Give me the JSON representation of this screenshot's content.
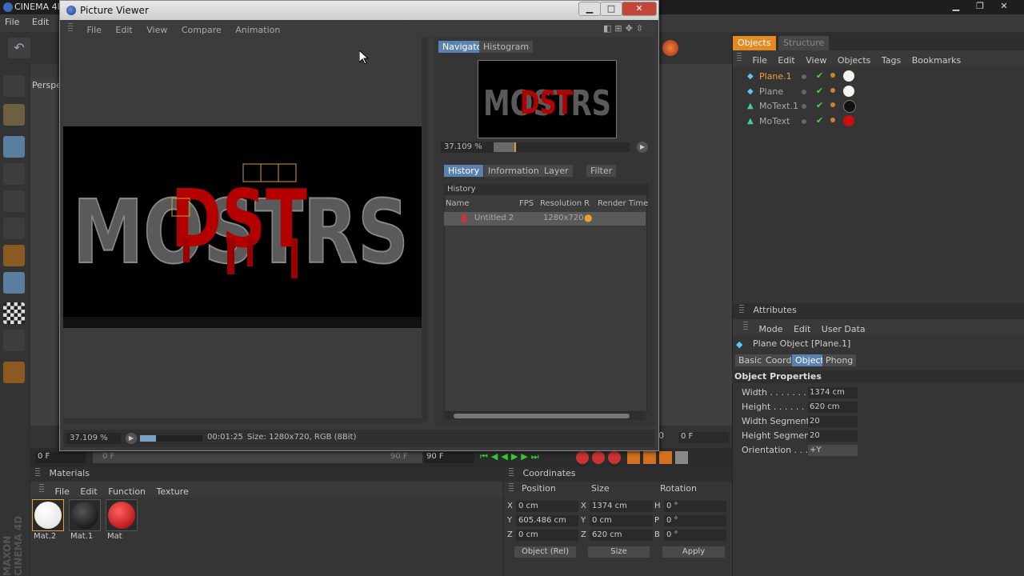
{
  "app": {
    "title": "CINEMA 4D",
    "menu": [
      "File",
      "Edit",
      "C"
    ],
    "viewport_label": "Perspe"
  },
  "left_tools": [
    "view-layout-icon",
    "live-selection-icon",
    "move-icon",
    "scale-icon",
    "rotate-icon",
    "grid-layout-icon",
    "quad-layout-icon",
    "object-layout-icon",
    "render-icon",
    "checker-icon",
    "uv-icon",
    "sculpt-icon"
  ],
  "maxon_logo": "MAXON CINEMA 4D",
  "objects_panel": {
    "tabs": [
      {
        "label": "Objects",
        "active": true
      },
      {
        "label": "Structure",
        "active": false
      }
    ],
    "menu": [
      "File",
      "Edit",
      "View",
      "Objects",
      "Tags",
      "Bookmarks"
    ],
    "rows": [
      {
        "name": "Plane.1",
        "icon": "plane-icon",
        "selected": true,
        "material": "#f5f5f0"
      },
      {
        "name": "Plane",
        "icon": "plane-icon",
        "selected": false,
        "material": "#f5f5f0"
      },
      {
        "name": "MoText.1",
        "icon": "motext-icon",
        "selected": false,
        "material": "#111111"
      },
      {
        "name": "MoText",
        "icon": "motext-icon",
        "selected": false,
        "material": "#c81010"
      }
    ]
  },
  "attributes": {
    "title": "Attributes",
    "menu": [
      "Mode",
      "Edit",
      "User Data"
    ],
    "object_label": "Plane Object [Plane.1]",
    "tabs": [
      {
        "label": "Basic",
        "active": false
      },
      {
        "label": "Coord",
        "active": false
      },
      {
        "label": "Object",
        "active": true
      },
      {
        "label": "Phong",
        "active": false
      }
    ],
    "section": "Object Properties",
    "fields": [
      {
        "label": "Width . . . . . . . .",
        "value": "1374 cm"
      },
      {
        "label": "Height . . . . . . . .",
        "value": "620 cm"
      },
      {
        "label": "Width Segments",
        "value": "20"
      },
      {
        "label": "Height Segments",
        "value": "20"
      },
      {
        "label": "Orientation . . . .",
        "value": "+Y"
      }
    ]
  },
  "timeline": {
    "start": "0 F",
    "current": "0 F",
    "end_a": "90 F",
    "end_b": "90 F",
    "tick_90": "90",
    "frame_right": "0 F"
  },
  "materials": {
    "title": "Materials",
    "menu": [
      "File",
      "Edit",
      "Function",
      "Texture"
    ],
    "items": [
      {
        "name": "Mat.2",
        "color": "#ffffff"
      },
      {
        "name": "Mat.1",
        "color": "#111111"
      },
      {
        "name": "Mat",
        "color": "#d01010"
      }
    ]
  },
  "coordinates": {
    "title": "Coordinates",
    "headers": [
      "Position",
      "Size",
      "Rotation"
    ],
    "rows": [
      {
        "axis": "X",
        "pos": "0 cm",
        "size_axis": "X",
        "size": "1374 cm",
        "rot_axis": "H",
        "rot": "0 °"
      },
      {
        "axis": "Y",
        "pos": "605.486 cm",
        "size_axis": "Y",
        "size": "0 cm",
        "rot_axis": "P",
        "rot": "0 °"
      },
      {
        "axis": "Z",
        "pos": "0 cm",
        "size_axis": "Z",
        "size": "620 cm",
        "rot_axis": "B",
        "rot": "0 °"
      }
    ],
    "mode": "Object (Rel)",
    "size_mode": "Size",
    "apply": "Apply"
  },
  "picture_viewer": {
    "title": "Picture Viewer",
    "menu": [
      "File",
      "Edit",
      "View",
      "Compare",
      "Animation"
    ],
    "render_text": "MOSTRS",
    "nav_tabs": [
      {
        "label": "Navigator",
        "active": true
      },
      {
        "label": "Histogram",
        "active": false
      }
    ],
    "zoom": "37.109 %",
    "zoom_fraction": 0.15,
    "info_tabs": [
      {
        "label": "History",
        "active": true
      },
      {
        "label": "Information",
        "active": false
      },
      {
        "label": "Layer",
        "active": false
      },
      {
        "label": "Filter",
        "active": false
      }
    ],
    "history_title": "History",
    "history_columns": [
      "Name",
      "FPS",
      "Resolution",
      "R",
      "Render Time"
    ],
    "history_rows": [
      {
        "name": "Untitled 2",
        "fps": "",
        "resolution": "1280x720",
        "r": "●",
        "time": ""
      }
    ],
    "status_zoom": "37.109 %",
    "status_time": "00:01:25",
    "status_info": "Size: 1280x720, RGB (8Bit)",
    "progress_fraction": 0.25
  }
}
